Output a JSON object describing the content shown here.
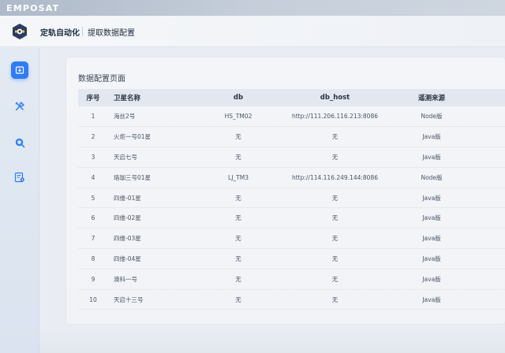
{
  "brand": "EMPOSAT",
  "header": {
    "app_name": "定轨自动化",
    "breadcrumb": "提取数据配置"
  },
  "sidebar": {
    "items": [
      {
        "name": "download-icon",
        "active": true
      },
      {
        "name": "tools-icon",
        "active": false
      },
      {
        "name": "search-globe-icon",
        "active": false
      },
      {
        "name": "list-settings-icon",
        "active": false
      }
    ]
  },
  "main": {
    "title": "数据配置页面",
    "table": {
      "columns": [
        "序号",
        "卫星名称",
        "db",
        "db_host",
        "遥测来源"
      ],
      "rows": [
        {
          "idx": "1",
          "name": "海丝2号",
          "db": "HS_TM02",
          "host": "http://111.206.116.213:8086",
          "src": "Node版"
        },
        {
          "idx": "2",
          "name": "火炬一号01星",
          "db": "无",
          "host": "无",
          "src": "Java版"
        },
        {
          "idx": "3",
          "name": "天启七号",
          "db": "无",
          "host": "无",
          "src": "Java版"
        },
        {
          "idx": "4",
          "name": "珞珈三号01星",
          "db": "LJ_TM3",
          "host": "http://114.116.249.144:8086",
          "src": "Node版"
        },
        {
          "idx": "5",
          "name": "四维-01星",
          "db": "无",
          "host": "无",
          "src": "Java版"
        },
        {
          "idx": "6",
          "name": "四维-02星",
          "db": "无",
          "host": "无",
          "src": "Java版"
        },
        {
          "idx": "7",
          "name": "四维-03星",
          "db": "无",
          "host": "无",
          "src": "Java版"
        },
        {
          "idx": "8",
          "name": "四维-04星",
          "db": "无",
          "host": "无",
          "src": "Java版"
        },
        {
          "idx": "9",
          "name": "澳科一号",
          "db": "无",
          "host": "无",
          "src": "Java版"
        },
        {
          "idx": "10",
          "name": "天启十三号",
          "db": "无",
          "host": "无",
          "src": "Java版"
        }
      ]
    }
  },
  "colors": {
    "accent": "#2f7cf6",
    "logo_bg": "#2b3b63"
  }
}
